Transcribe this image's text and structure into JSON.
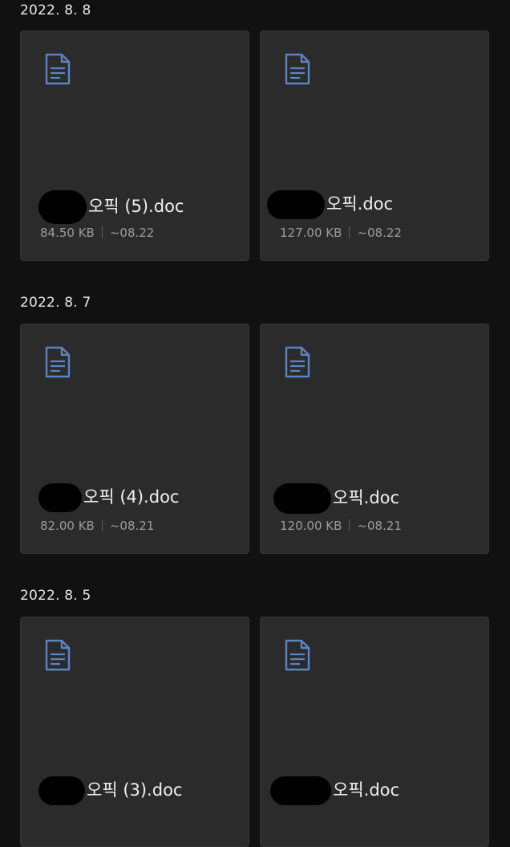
{
  "groups": [
    {
      "date": "2022. 8. 8",
      "files": [
        {
          "name": "오픽 (5).doc",
          "size": "84.50 KB",
          "modified": "~08.22"
        },
        {
          "name": "오픽.doc",
          "size": "127.00 KB",
          "modified": "~08.22"
        }
      ]
    },
    {
      "date": "2022. 8. 7",
      "files": [
        {
          "name": "오픽 (4).doc",
          "size": "82.00 KB",
          "modified": "~08.21"
        },
        {
          "name": "오픽.doc",
          "size": "120.00 KB",
          "modified": "~08.21"
        }
      ]
    },
    {
      "date": "2022. 8. 5",
      "files": [
        {
          "name": "오픽 (3).doc",
          "size": "",
          "modified": ""
        },
        {
          "name": "오픽.doc",
          "size": "",
          "modified": ""
        }
      ]
    }
  ],
  "icons": {
    "file": "document-icon",
    "color": "#5b84c4"
  }
}
